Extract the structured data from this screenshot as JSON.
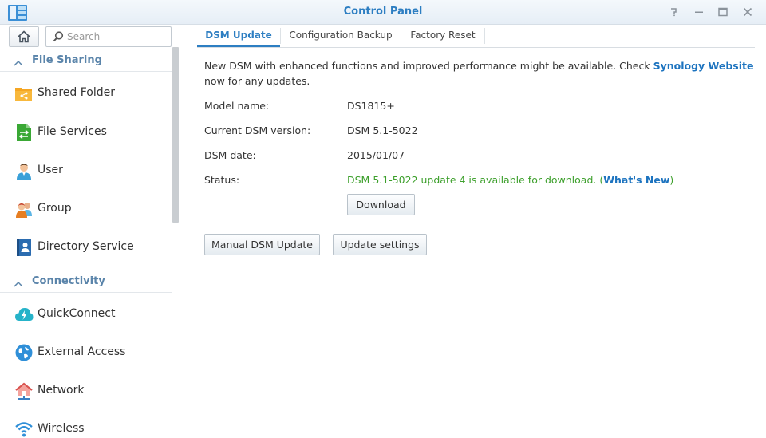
{
  "window": {
    "title": "Control Panel",
    "app_icon": "control-panel-icon",
    "controls": [
      "help-icon",
      "minimize-icon",
      "maximize-icon",
      "close-icon"
    ]
  },
  "sidebar": {
    "search_placeholder": "Search",
    "sections": [
      {
        "label": "File Sharing",
        "items": [
          {
            "label": "Shared Folder",
            "icon": "shared-folder-icon"
          },
          {
            "label": "File Services",
            "icon": "file-services-icon"
          },
          {
            "label": "User",
            "icon": "user-icon"
          },
          {
            "label": "Group",
            "icon": "group-icon"
          },
          {
            "label": "Directory Service",
            "icon": "directory-service-icon"
          }
        ]
      },
      {
        "label": "Connectivity",
        "items": [
          {
            "label": "QuickConnect",
            "icon": "quickconnect-icon"
          },
          {
            "label": "External Access",
            "icon": "external-access-icon"
          },
          {
            "label": "Network",
            "icon": "network-icon"
          },
          {
            "label": "Wireless",
            "icon": "wireless-icon"
          }
        ]
      }
    ]
  },
  "tabs": [
    {
      "label": "DSM Update",
      "active": true
    },
    {
      "label": "Configuration Backup",
      "active": false
    },
    {
      "label": "Factory Reset",
      "active": false
    }
  ],
  "update": {
    "intro_before": "New DSM with enhanced functions and improved performance might be available. Check ",
    "intro_link": "Synology Website",
    "intro_after": " now for any updates.",
    "model_label": "Model name:",
    "model_value": "DS1815+",
    "version_label": "Current DSM version:",
    "version_value": "DSM 5.1-5022",
    "date_label": "DSM date:",
    "date_value": "2015/01/07",
    "status_label": "Status:",
    "status_text": "DSM 5.1-5022 update 4 is available for download. (",
    "status_link": "What's New",
    "status_close": ")",
    "download_button": "Download",
    "manual_update_button": "Manual DSM Update",
    "settings_button": "Update settings"
  },
  "colors": {
    "accent": "#2d7ec2",
    "link": "#1c73bf",
    "status_green": "#3c9f2b"
  }
}
